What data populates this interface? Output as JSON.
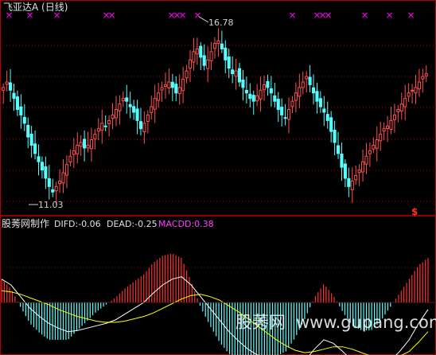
{
  "header": {
    "title": "飞亚达A (日线)"
  },
  "price_panel": {
    "high_label": "16.78",
    "low_label": "11.03",
    "signal_glyph": "$",
    "marker_glyph": "×",
    "marker_color": "#ff00ff"
  },
  "indicator_panel": {
    "name": "股莠网制作",
    "difd_label": "DIFD:-0.06",
    "dead_label": "DEAD:-0.25",
    "macdd_label": "MACDD:0.38"
  },
  "watermark": {
    "cn": "股莠网",
    "url": "www.gupang.com"
  },
  "colors": {
    "up": "#ff5050",
    "down": "#54ffff",
    "grid": "#a00000",
    "border": "#b00000",
    "label": "#d0d0d0",
    "difd_line": "#ffffff",
    "dead_line": "#ffff00",
    "macdd": "#ff00ff",
    "hist_pos": "#ff3030",
    "hist_neg": "#60ffff"
  },
  "chart_data": [
    {
      "type": "candlestick",
      "title": "飞亚达A (日线)",
      "ylim": [
        10.6,
        17.6
      ],
      "grid": true,
      "annotations": [
        {
          "label": "16.78",
          "kind": "high",
          "value": 16.78
        },
        {
          "label": "11.03",
          "kind": "low",
          "value": 11.03
        }
      ],
      "closes": [
        15.0,
        15.2,
        14.9,
        14.6,
        14.2,
        14.0,
        13.7,
        13.2,
        12.9,
        12.6,
        12.3,
        12.0,
        11.7,
        11.4,
        11.2,
        11.4,
        11.6,
        11.9,
        12.2,
        12.5,
        12.7,
        12.9,
        13.0,
        12.8,
        12.9,
        13.1,
        13.3,
        13.5,
        13.7,
        13.6,
        13.8,
        14.0,
        14.2,
        14.4,
        14.6,
        14.5,
        14.3,
        14.1,
        13.8,
        13.5,
        13.7,
        14.0,
        14.3,
        14.6,
        14.8,
        15.0,
        15.1,
        15.2,
        15.0,
        14.8,
        15.0,
        15.3,
        15.6,
        16.0,
        16.3,
        16.4,
        16.1,
        15.8,
        16.0,
        16.3,
        16.6,
        16.7,
        16.4,
        16.0,
        15.7,
        15.5,
        15.6,
        15.2,
        15.0,
        14.8,
        14.6,
        14.5,
        14.7,
        14.9,
        15.1,
        15.0,
        14.8,
        14.5,
        14.2,
        14.0,
        13.9,
        14.2,
        14.5,
        14.8,
        15.0,
        15.2,
        15.4,
        15.1,
        14.8,
        14.5,
        14.3,
        14.1,
        13.8,
        13.4,
        13.0,
        12.6,
        12.1,
        11.7,
        11.4,
        11.6,
        11.8,
        12.0,
        12.3,
        12.5,
        12.7,
        12.9,
        13.1,
        13.3,
        13.5,
        13.6,
        13.8,
        14.0,
        14.2,
        14.4,
        14.6,
        14.8,
        14.9,
        15.0,
        15.2,
        15.4,
        15.5
      ]
    },
    {
      "type": "line+bar",
      "title": "股莠网制作",
      "ylim": [
        -0.6,
        0.6
      ],
      "series": [
        {
          "name": "DIFD",
          "latest": -0.06,
          "values": [
            0.2,
            0.15,
            0.05,
            -0.05,
            -0.12,
            -0.18,
            -0.22,
            -0.25,
            -0.24,
            -0.22,
            -0.2,
            -0.18,
            -0.15,
            -0.1,
            -0.05,
            0.0,
            0.08,
            0.15,
            0.2,
            0.22,
            0.15,
            0.05,
            -0.05,
            -0.15,
            -0.25,
            -0.33,
            -0.4,
            -0.45,
            -0.5,
            -0.55,
            -0.58,
            -0.56,
            -0.5,
            -0.4,
            -0.32,
            -0.35,
            -0.42,
            -0.5,
            -0.55,
            -0.58,
            -0.56,
            -0.5,
            -0.42,
            -0.32,
            -0.18,
            -0.06
          ]
        },
        {
          "name": "DEAD",
          "latest": -0.25,
          "values": [
            0.1,
            0.09,
            0.07,
            0.04,
            0.01,
            -0.02,
            -0.06,
            -0.09,
            -0.12,
            -0.14,
            -0.16,
            -0.17,
            -0.17,
            -0.16,
            -0.14,
            -0.12,
            -0.09,
            -0.05,
            -0.01,
            0.03,
            0.06,
            0.07,
            0.05,
            0.02,
            -0.03,
            -0.08,
            -0.14,
            -0.2,
            -0.26,
            -0.32,
            -0.37,
            -0.41,
            -0.43,
            -0.42,
            -0.4,
            -0.38,
            -0.38,
            -0.4,
            -0.43,
            -0.46,
            -0.48,
            -0.48,
            -0.46,
            -0.42,
            -0.34,
            -0.25
          ]
        },
        {
          "name": "MACDD",
          "latest": 0.38,
          "values": [
            0.2,
            0.12,
            -0.04,
            -0.18,
            -0.26,
            -0.32,
            -0.32,
            -0.32,
            -0.24,
            -0.16,
            -0.08,
            -0.02,
            0.04,
            0.12,
            0.18,
            0.24,
            0.34,
            0.4,
            0.42,
            0.38,
            0.18,
            -0.04,
            -0.2,
            -0.34,
            -0.44,
            -0.5,
            -0.52,
            -0.5,
            -0.48,
            -0.46,
            -0.42,
            -0.3,
            -0.14,
            0.04,
            0.16,
            0.06,
            -0.08,
            -0.2,
            -0.24,
            -0.24,
            -0.16,
            -0.04,
            0.08,
            0.2,
            0.32,
            0.38
          ]
        }
      ]
    }
  ]
}
